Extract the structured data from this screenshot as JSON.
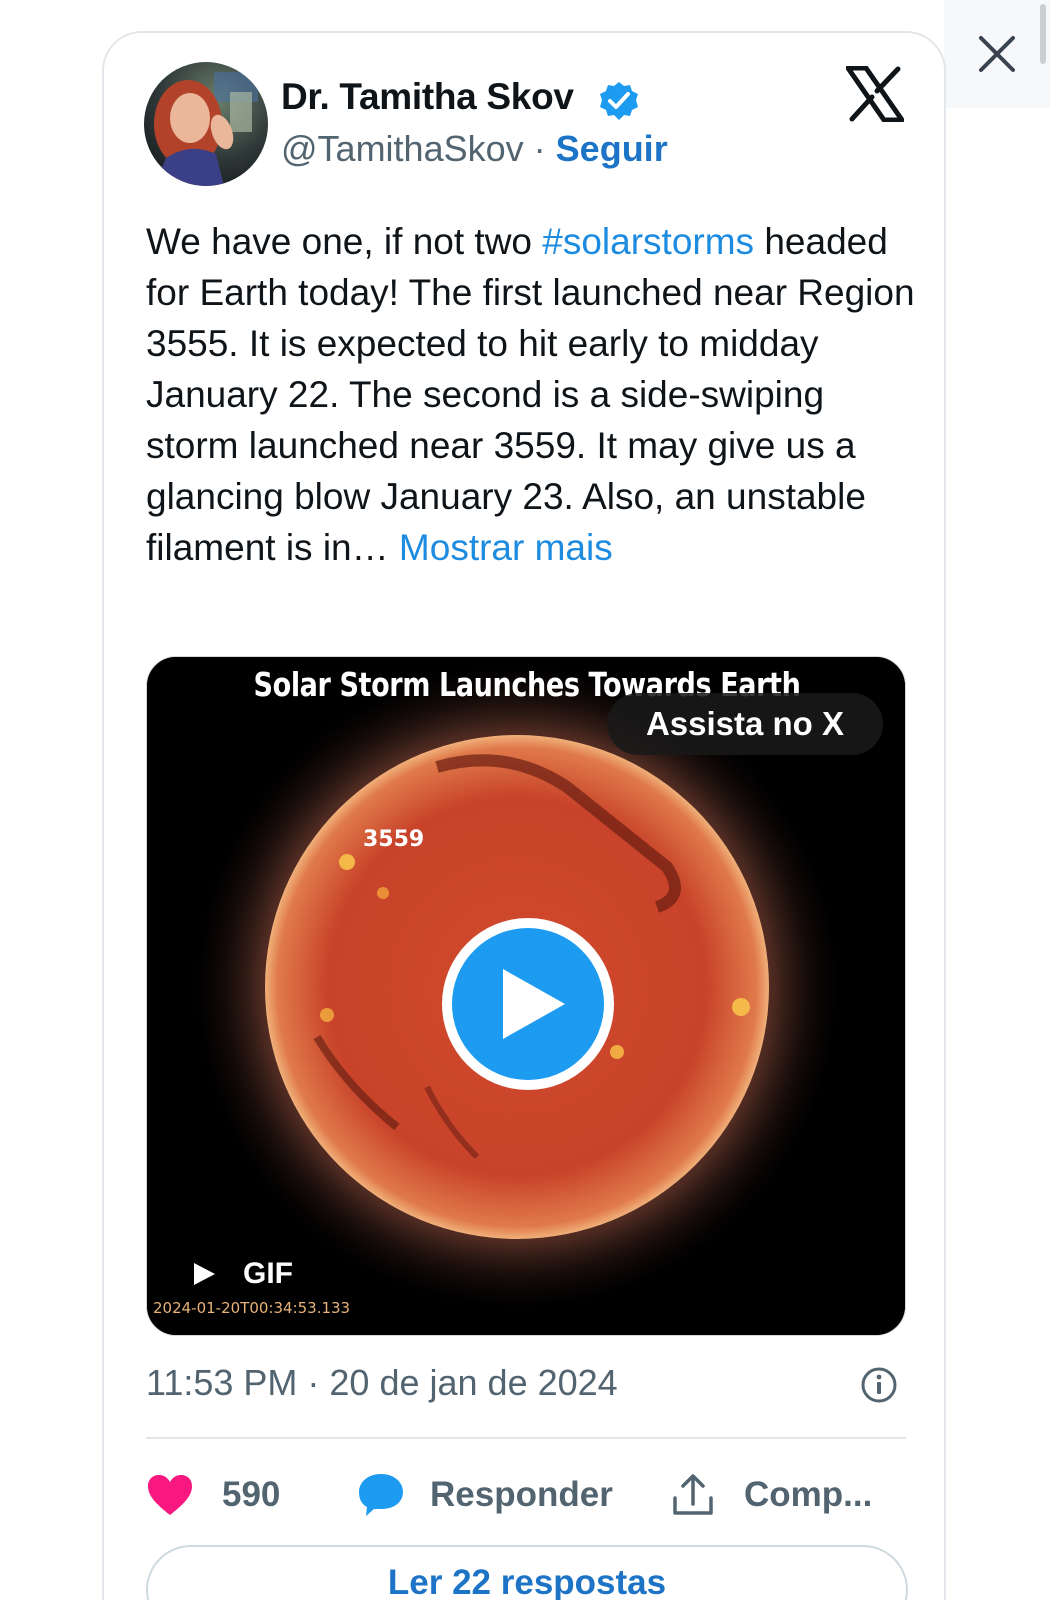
{
  "tweet": {
    "author_name": "Dr. Tamitha Skov",
    "handle": "@TamithaSkov",
    "separator": "·",
    "follow_label": "Seguir",
    "text_before_hashtag": "We have one, if not two ",
    "hashtag": "#solarstorms",
    "text_after_hashtag": " headed for Earth today! The first launched near Region 3555. It is expected to hit early to midday January 22. The second is a side-swiping storm launched near 3559. It may give us a glancing blow January 23. Also, an unstable filament is in… ",
    "show_more": "Mostrar mais",
    "timestamp": "11:53 PM · 20 de jan de 2024"
  },
  "media": {
    "title": "Solar Storm Launches Towards Earth",
    "watch_label": "Assista no X",
    "region_label": "3559",
    "gif_label": "GIF",
    "overlay_timestamp": "2024-01-20T00:34:53.133"
  },
  "actions": {
    "like_count": "590",
    "reply_label": "Responder",
    "share_label": "Comp..."
  },
  "replies_button": "Ler 22 respostas",
  "colors": {
    "link": "#1d8ce0",
    "follow": "#1d74c7",
    "like": "#f91880",
    "reply": "#1d9bf0",
    "play": "#1d9bf0"
  },
  "icons": [
    "close-icon",
    "verified-badge-icon",
    "x-logo-icon",
    "play-icon",
    "info-icon",
    "heart-icon",
    "reply-bubble-icon",
    "share-icon"
  ]
}
